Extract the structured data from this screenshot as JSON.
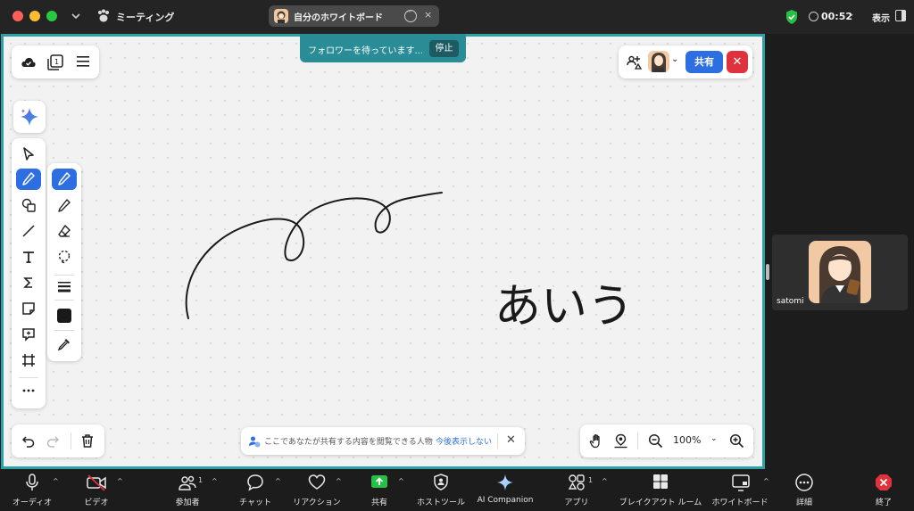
{
  "titlebar": {
    "app_title": "ミーティング",
    "tab_title": "自分のホワイトボード",
    "tab_close": "×",
    "timer": "00:52",
    "view_label": "表示"
  },
  "whiteboard": {
    "follower_message": "フォロワーを待っています...",
    "stop_label": "停止",
    "share_label": "共有",
    "close_label": "✕",
    "notice_text": "ここであなたが共有する内容を閲覧できる人物",
    "notice_link": "今後表示しない",
    "zoom": "100%",
    "handwriting_text": "あいう",
    "pen_color": "#1a1a1a"
  },
  "participant": {
    "name": "satomi"
  },
  "bottombar": {
    "audio": "オーディオ",
    "video": "ビデオ",
    "participants": "参加者",
    "participants_count": "1",
    "chat": "チャット",
    "reactions": "リアクション",
    "share": "共有",
    "host_tools": "ホストツール",
    "ai_companion": "AI Companion",
    "apps": "アプリ",
    "apps_count": "1",
    "breakout": "ブレイクアウト ルーム",
    "whiteboard": "ホワイトボード",
    "more": "詳細",
    "end": "終了"
  },
  "colors": {
    "accent": "#2d6fe0",
    "frame": "#2ea1a6",
    "danger": "#e0323c",
    "share_green": "#26c046"
  }
}
